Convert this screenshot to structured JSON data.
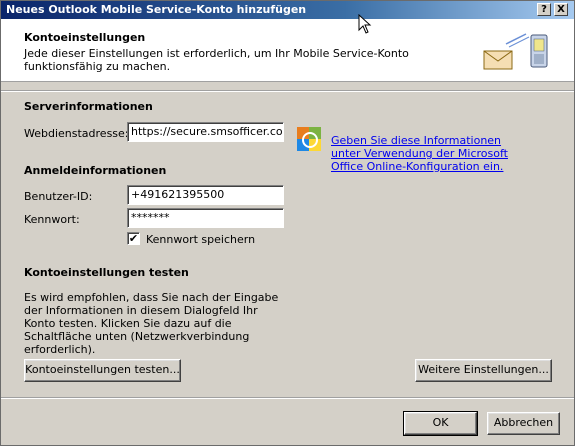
{
  "window": {
    "title": "Neues Outlook Mobile Service-Konto hinzufügen",
    "help_button": "?",
    "close_button": "X"
  },
  "header": {
    "title": "Kontoeinstellungen",
    "description": "Jede dieser Einstellungen ist erforderlich, um Ihr Mobile Service-Konto funktionsfähig zu machen."
  },
  "server": {
    "section_title": "Serverinformationen",
    "webservice_label": "Webdienstadresse:",
    "webservice_value": "https://secure.smsofficer.com/c",
    "link_text": "Geben Sie diese Informationen unter Verwendung der Microsoft Office Online-Konfiguration ein."
  },
  "login": {
    "section_title": "Anmeldeinformationen",
    "userid_label": "Benutzer-ID:",
    "userid_value": "+491621395500",
    "password_label": "Kennwort:",
    "password_value": "*******",
    "save_password_label": "Kennwort speichern",
    "save_password_checked": true
  },
  "test": {
    "section_title": "Kontoeinstellungen testen",
    "description": "Es wird empfohlen, dass Sie nach der Eingabe der Informationen in diesem Dialogfeld Ihr Konto testen. Klicken Sie dazu auf die Schaltfläche unten (Netzwerkverbindung erforderlich).",
    "test_button": "Kontoeinstellungen testen...",
    "more_settings_button": "Weitere Einstellungen..."
  },
  "footer": {
    "ok_button": "OK",
    "cancel_button": "Abbrechen"
  },
  "check_glyph": "✔"
}
